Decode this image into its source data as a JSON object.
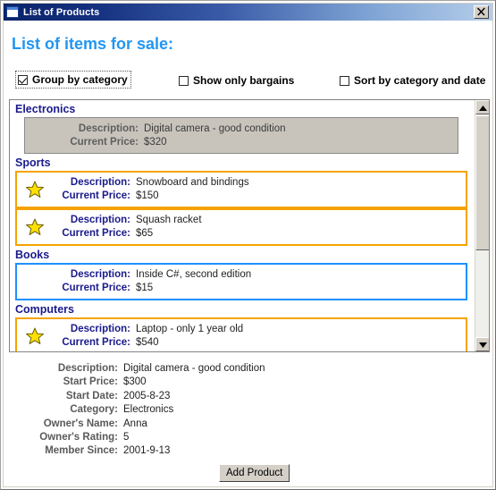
{
  "window": {
    "title": "List of Products",
    "icon": "window-form-icon",
    "close_label": "✕"
  },
  "heading": "List of items for sale:",
  "options": [
    {
      "id": "group",
      "label": "Group by category",
      "checked": true,
      "focused": true
    },
    {
      "id": "bargains",
      "label": "Show only bargains",
      "checked": false,
      "focused": false
    },
    {
      "id": "sort",
      "label": "Sort by category and date",
      "checked": false,
      "focused": false
    }
  ],
  "list": {
    "field_labels": {
      "description": "Description:",
      "current_price": "Current Price:"
    },
    "groups": [
      {
        "name": "Electronics",
        "items": [
          {
            "description": "Digital camera - good condition",
            "current_price": "$320",
            "style": "selected",
            "starred": false
          }
        ]
      },
      {
        "name": "Sports",
        "items": [
          {
            "description": "Snowboard and bindings",
            "current_price": "$150",
            "style": "orange",
            "starred": true
          },
          {
            "description": "Squash racket",
            "current_price": "$65",
            "style": "orange",
            "starred": true
          }
        ]
      },
      {
        "name": "Books",
        "items": [
          {
            "description": "Inside C#, second edition",
            "current_price": "$15",
            "style": "blue",
            "starred": false
          }
        ]
      },
      {
        "name": "Computers",
        "items": [
          {
            "description": "Laptop - only 1 year old",
            "current_price": "$540",
            "style": "orange",
            "starred": true
          }
        ]
      }
    ]
  },
  "details": [
    {
      "label": "Description:",
      "value": "Digital camera - good condition"
    },
    {
      "label": "Start Price:",
      "value": "$300"
    },
    {
      "label": "Start Date:",
      "value": "2005-8-23"
    },
    {
      "label": "Category:",
      "value": "Electronics"
    },
    {
      "label": "Owner's Name:",
      "value": "Anna"
    },
    {
      "label": "Owner's Rating:",
      "value": "5"
    },
    {
      "label": "Member Since:",
      "value": "2001-9-13"
    }
  ],
  "add_button": "Add Product",
  "colors": {
    "heading": "#2196f3",
    "group_header": "#1a1a8c",
    "item_border_orange": "#f5a300",
    "item_border_blue": "#1e90ff",
    "selected_bg": "#c8c4bc",
    "star_fill": "#ffe000",
    "titlebar_start": "#0a246a",
    "titlebar_end": "#b5cdea"
  }
}
